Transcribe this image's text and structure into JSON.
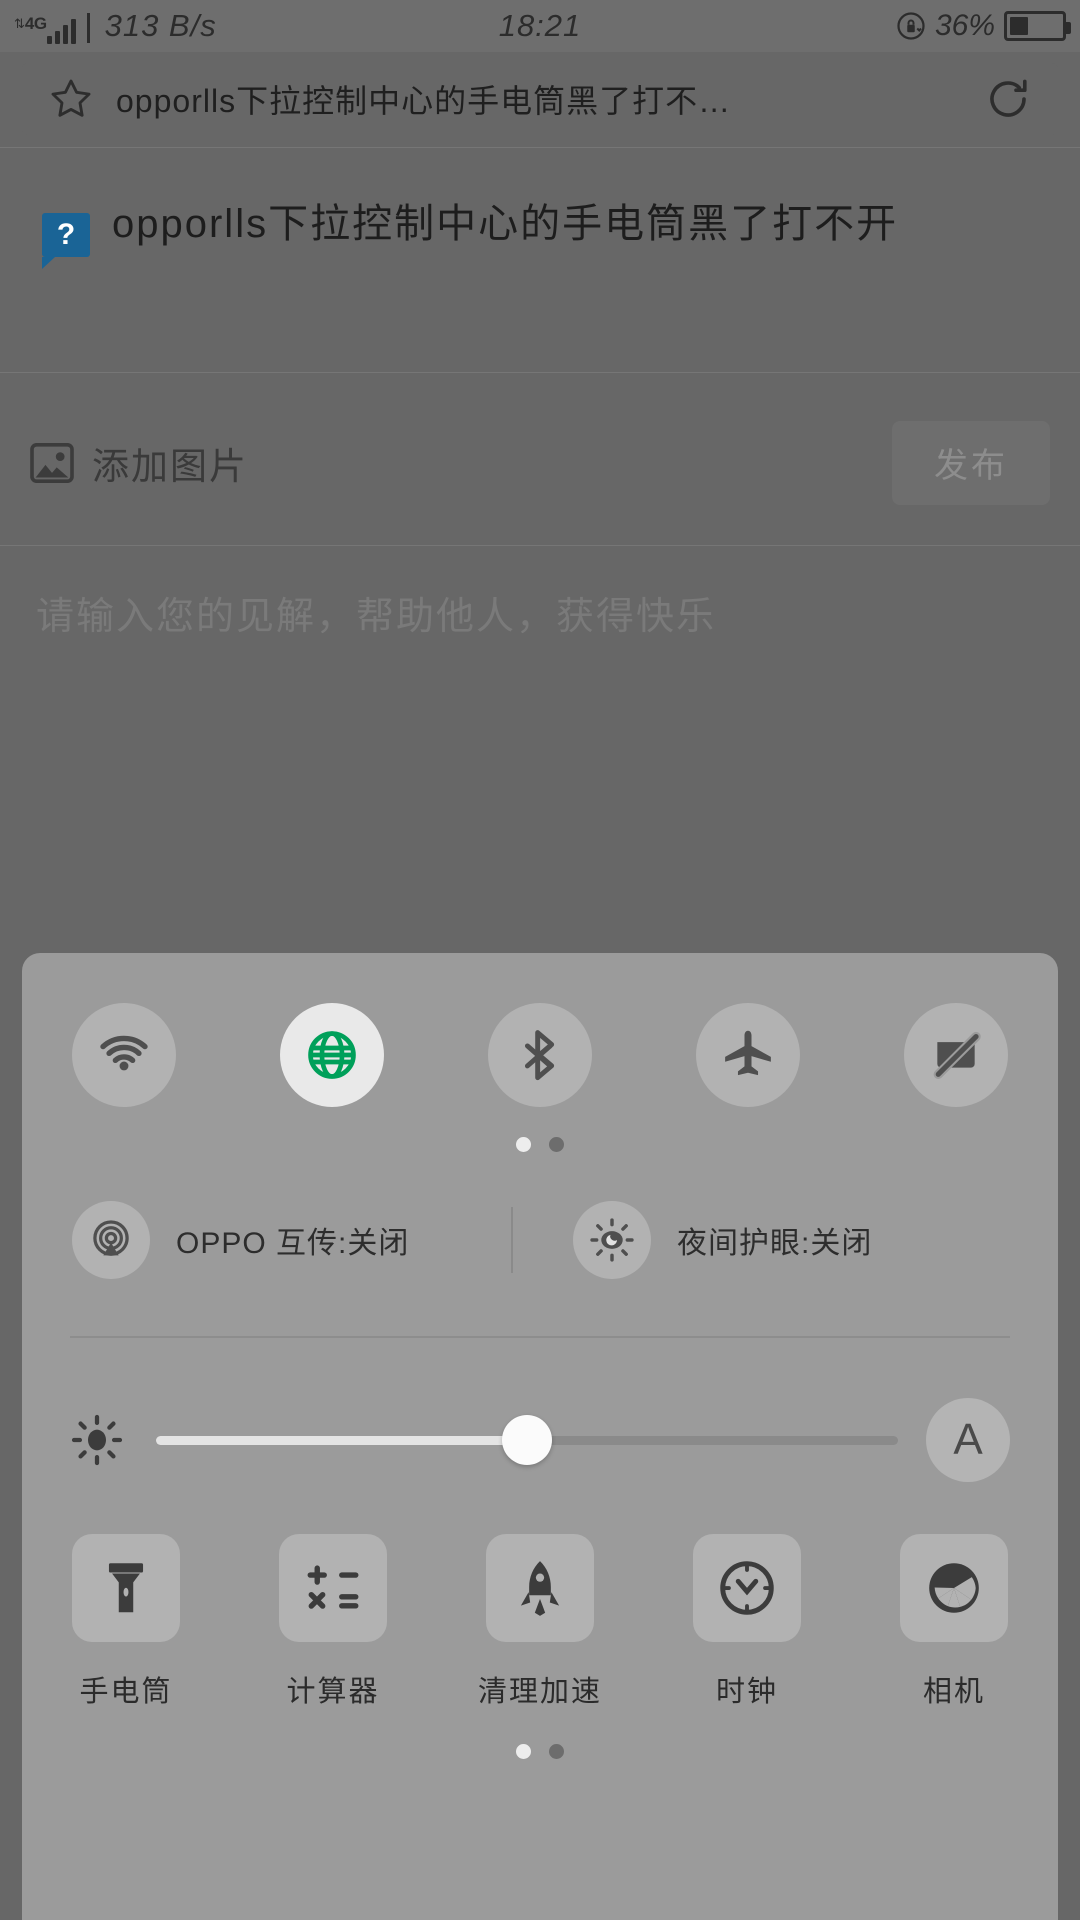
{
  "status_bar": {
    "network_type": "4G",
    "network_speed": "313 B/s",
    "time": "18:21",
    "battery_percent": "36%",
    "battery_level": 36,
    "lock_icon": "rotation-lock-icon"
  },
  "search_bar": {
    "star_icon": "star-icon",
    "query": "opporlls下拉控制中心的手电筒黑了打不…",
    "refresh_icon": "refresh-icon"
  },
  "question": {
    "badge": "?",
    "title": "opporlls下拉控制中心的手电筒黑了打不开"
  },
  "compose": {
    "image_icon": "image-icon",
    "add_image_label": "添加图片",
    "publish_label": "发布",
    "answer_placeholder": "请输入您的见解，帮助他人，获得快乐"
  },
  "control_center": {
    "toggles": [
      {
        "name": "wifi",
        "icon": "wifi-icon",
        "active": false
      },
      {
        "name": "mobile-data",
        "icon": "globe-icon",
        "active": true
      },
      {
        "name": "bluetooth",
        "icon": "bluetooth-icon",
        "active": false
      },
      {
        "name": "airplane-mode",
        "icon": "airplane-icon",
        "active": false
      },
      {
        "name": "do-not-disturb",
        "icon": "no-notification-icon",
        "active": false
      }
    ],
    "toggle_pages": {
      "count": 2,
      "current": 1
    },
    "features": [
      {
        "name": "oppo-share",
        "icon": "broadcast-icon",
        "label": "OPPO 互传:关闭",
        "state": "关闭"
      },
      {
        "name": "night-shield",
        "icon": "eye-sun-icon",
        "label": "夜间护眼:关闭",
        "state": "关闭"
      }
    ],
    "brightness": {
      "icon": "brightness-icon",
      "value_percent": 50,
      "auto_label": "A"
    },
    "shortcuts": [
      {
        "name": "flashlight",
        "icon": "flashlight-icon",
        "label": "手电筒"
      },
      {
        "name": "calculator",
        "icon": "calculator-icon",
        "label": "计算器"
      },
      {
        "name": "clean-boost",
        "icon": "rocket-icon",
        "label": "清理加速"
      },
      {
        "name": "clock",
        "icon": "clock-icon",
        "label": "时钟"
      },
      {
        "name": "camera",
        "icon": "aperture-icon",
        "label": "相机"
      }
    ],
    "shortcut_pages": {
      "count": 2,
      "current": 1
    }
  },
  "colors": {
    "accent_green": "#00a05a",
    "badge_blue": "#1a6496",
    "panel_bg": "#9b9b9b",
    "page_bg": "#676767"
  }
}
